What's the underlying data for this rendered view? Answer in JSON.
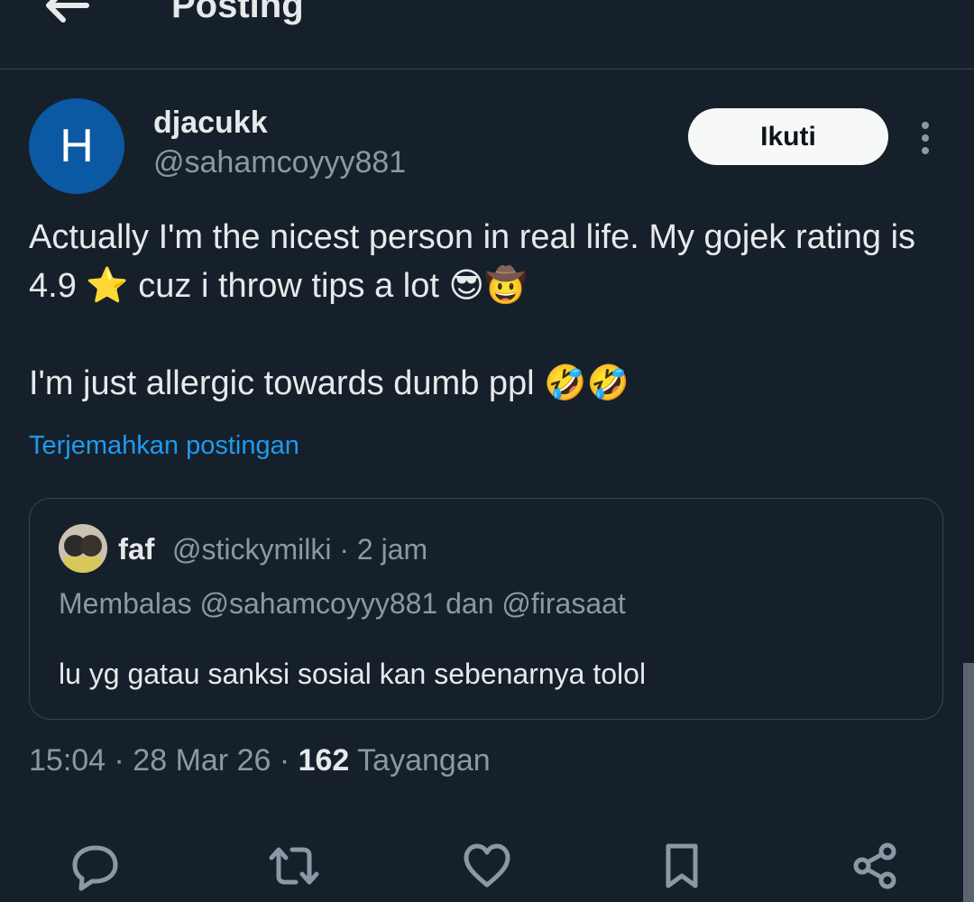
{
  "header": {
    "title": "Posting",
    "back_icon": "arrow-left-icon"
  },
  "author": {
    "avatar_letter": "H",
    "avatar_color": "#0b58a3",
    "name": "djacukk",
    "handle": "@sahamcoyyy881",
    "follow_label": "Ikuti",
    "more_icon": "more-vertical-icon"
  },
  "post": {
    "line1": "Actually I'm the nicest person in real life. My gojek rating is 4.9 ⭐ cuz i throw tips a lot 😎🤠",
    "line2": "I'm just allergic towards dumb ppl 🤣🤣",
    "translate_label": "Terjemahkan postingan"
  },
  "quote": {
    "name": "faf",
    "meta": "@stickymilki · 2 jam",
    "reply_to": "Membalas @sahamcoyyy881 dan @firasaat",
    "text": "lu yg gatau sanksi sosial kan sebenarnya tolol"
  },
  "stats": {
    "time_date": "15:04 · 28 Mar 26 · ",
    "views": "162",
    "views_label": " Tayangan"
  },
  "actions": [
    "reply-icon",
    "repost-icon",
    "like-icon",
    "bookmark-icon",
    "share-icon"
  ],
  "colors": {
    "background": "#16202a",
    "accent": "#1d9bf0",
    "muted": "#8b98a5"
  }
}
